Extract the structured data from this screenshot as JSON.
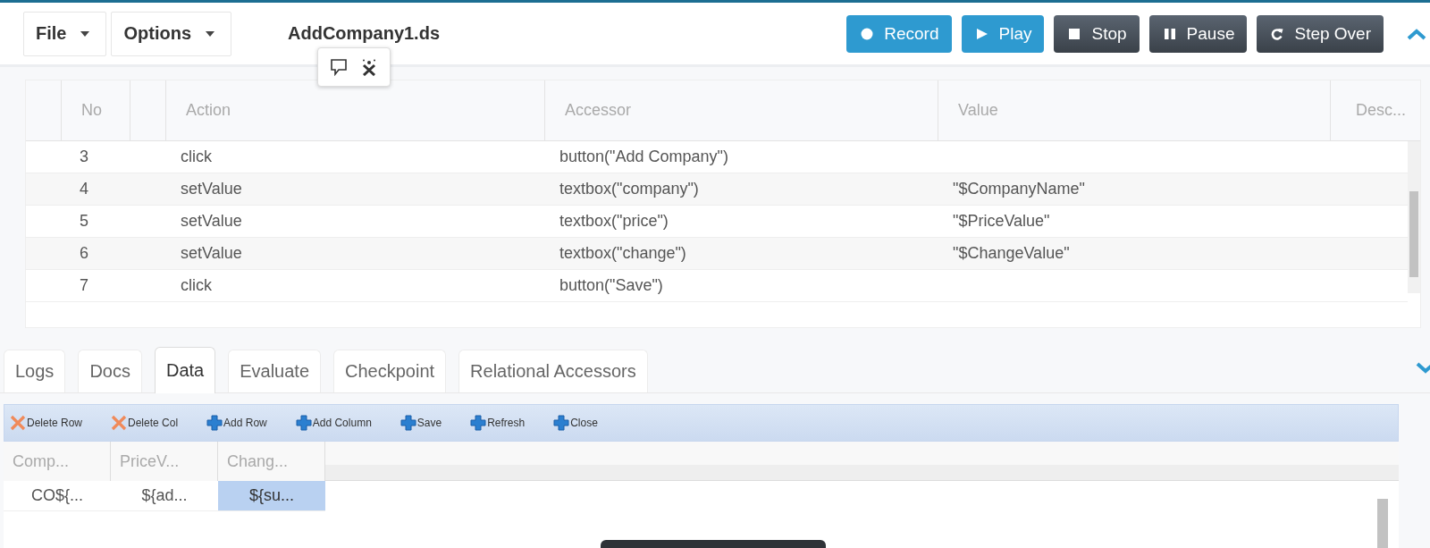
{
  "toolbar": {
    "menus": [
      {
        "label": "File"
      },
      {
        "label": "Options"
      }
    ],
    "file_name": "AddCompany1.ds",
    "buttons": [
      {
        "label": "Record",
        "kind": "record"
      },
      {
        "label": "Play",
        "kind": "play"
      },
      {
        "label": "Stop",
        "kind": "stop"
      },
      {
        "label": "Pause",
        "kind": "pause"
      },
      {
        "label": "Step Over",
        "kind": "step"
      }
    ]
  },
  "steps_table": {
    "columns": [
      "No",
      "Action",
      "Accessor",
      "Value",
      "Desc..."
    ],
    "rows": [
      {
        "no": "3",
        "action": "click",
        "accessor": "button(\"Add Company\")"
      },
      {
        "no": "4",
        "action": "setValue",
        "accessor": "textbox(\"company\")",
        "value": "\"$CompanyName\""
      },
      {
        "no": "5",
        "action": "setValue",
        "accessor": "textbox(\"price\")",
        "value": "\"$PriceValue\""
      },
      {
        "no": "6",
        "action": "setValue",
        "accessor": "textbox(\"change\")",
        "value": "\"$ChangeValue\""
      },
      {
        "no": "7",
        "action": "click",
        "accessor": "button(\"Save\")"
      }
    ]
  },
  "bottom_tabs": [
    {
      "label": "Logs",
      "selected": false
    },
    {
      "label": "Docs",
      "selected": false
    },
    {
      "label": "Data",
      "selected": true
    },
    {
      "label": "Evaluate",
      "selected": false
    },
    {
      "label": "Checkpoint",
      "selected": false
    },
    {
      "label": "Relational Accessors",
      "selected": false
    }
  ],
  "data_toolbar": [
    {
      "label": "Delete Row",
      "kind": "delete"
    },
    {
      "label": "Delete Col",
      "kind": "delete"
    },
    {
      "label": "Add Row",
      "kind": "add"
    },
    {
      "label": "Add Column",
      "kind": "add"
    },
    {
      "label": "Save",
      "kind": "add"
    },
    {
      "label": "Refresh",
      "kind": "add"
    },
    {
      "label": "Close",
      "kind": "add"
    }
  ],
  "data_grid": {
    "columns": [
      "Comp...",
      "PriceV...",
      "Chang..."
    ],
    "rows": [
      {
        "cells": [
          {
            "text": "CO${...",
            "selected": false
          },
          {
            "text": "${ad...",
            "selected": false
          },
          {
            "text": "${su...",
            "selected": true
          }
        ]
      }
    ]
  }
}
